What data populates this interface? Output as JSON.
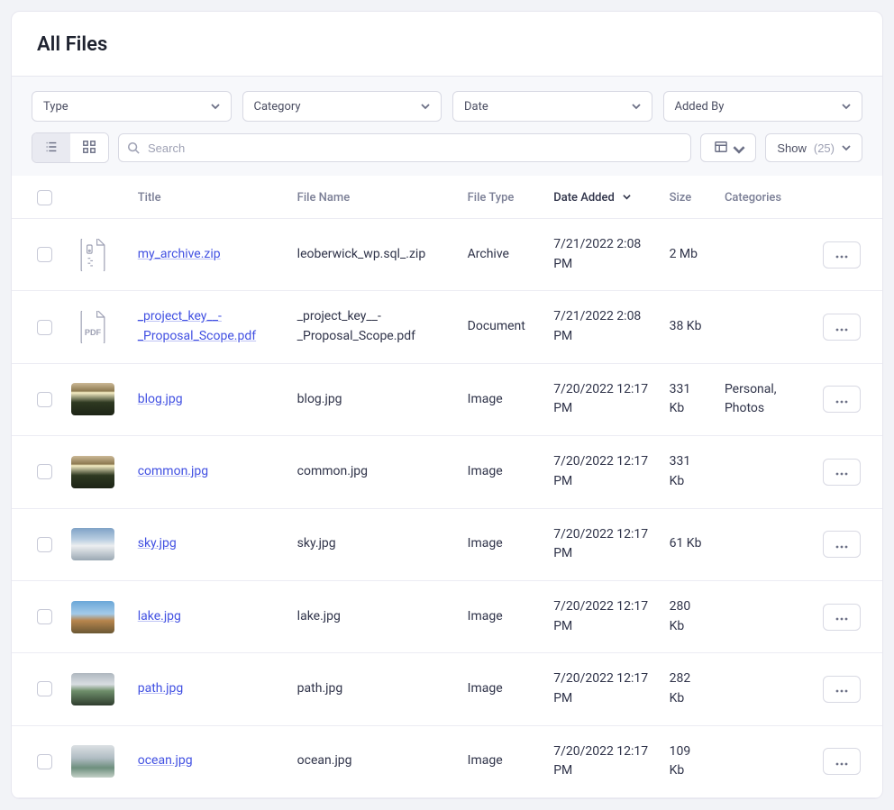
{
  "header": {
    "title": "All Files"
  },
  "filters": {
    "type": {
      "label": "Type"
    },
    "category": {
      "label": "Category"
    },
    "date": {
      "label": "Date"
    },
    "added_by": {
      "label": "Added By"
    }
  },
  "search": {
    "placeholder": "Search"
  },
  "show": {
    "label": "Show",
    "count": "(25)"
  },
  "columns": {
    "title": "Title",
    "filename": "File Name",
    "filetype": "File Type",
    "date_added": "Date Added",
    "size": "Size",
    "categories": "Categories"
  },
  "rows": [
    {
      "thumb_kind": "zip-icon",
      "title": "my_archive.zip",
      "filename": "leoberwick_wp.sql_.zip",
      "filetype": "Archive",
      "date": "7/21/2022 2:08 PM",
      "size": "2 Mb",
      "categories": ""
    },
    {
      "thumb_kind": "pdf-icon",
      "title": "_project_key__-_Proposal_Scope.pdf",
      "filename": "_project_key__-_Proposal_Scope.pdf",
      "filetype": "Document",
      "date": "7/21/2022 2:08 PM",
      "size": "38 Kb",
      "categories": ""
    },
    {
      "thumb_kind": "thumb-grad-a",
      "title": "blog.jpg",
      "filename": "blog.jpg",
      "filetype": "Image",
      "date": "7/20/2022 12:17 PM",
      "size": "331 Kb",
      "categories": "Personal, Photos"
    },
    {
      "thumb_kind": "thumb-grad-a",
      "title": "common.jpg",
      "filename": "common.jpg",
      "filetype": "Image",
      "date": "7/20/2022 12:17 PM",
      "size": "331 Kb",
      "categories": ""
    },
    {
      "thumb_kind": "thumb-grad-b",
      "title": "sky.jpg",
      "filename": "sky.jpg",
      "filetype": "Image",
      "date": "7/20/2022 12:17 PM",
      "size": "61 Kb",
      "categories": ""
    },
    {
      "thumb_kind": "thumb-grad-c",
      "title": "lake.jpg",
      "filename": "lake.jpg",
      "filetype": "Image",
      "date": "7/20/2022 12:17 PM",
      "size": "280 Kb",
      "categories": ""
    },
    {
      "thumb_kind": "thumb-grad-d",
      "title": "path.jpg",
      "filename": "path.jpg",
      "filetype": "Image",
      "date": "7/20/2022 12:17 PM",
      "size": "282 Kb",
      "categories": ""
    },
    {
      "thumb_kind": "thumb-grad-e",
      "title": "ocean.jpg",
      "filename": "ocean.jpg",
      "filetype": "Image",
      "date": "7/20/2022 12:17 PM",
      "size": "109 Kb",
      "categories": ""
    }
  ]
}
